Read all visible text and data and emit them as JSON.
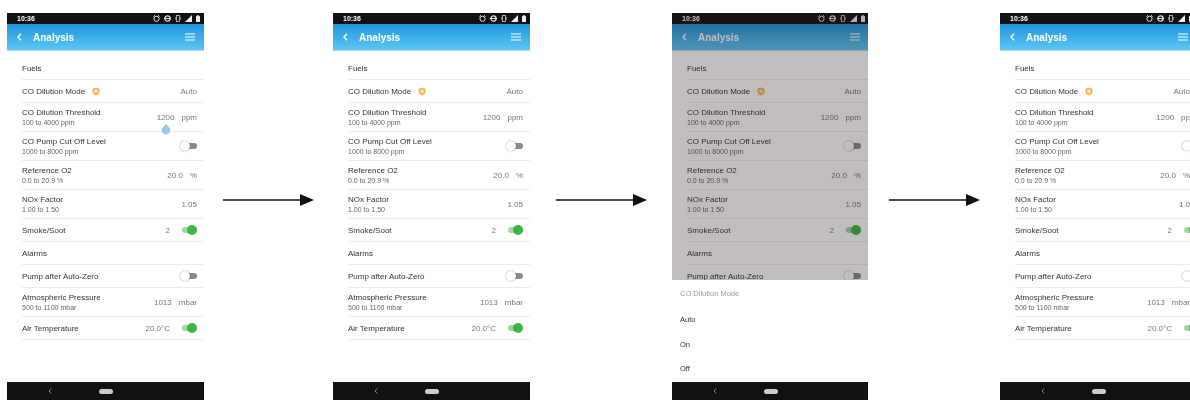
{
  "screens": [
    {
      "status_bar": {
        "time": "10:36"
      },
      "app_bar": {
        "title": "Analysis"
      },
      "dimmed": false,
      "rows": [
        {
          "kind": "section",
          "label": "Fuels"
        },
        {
          "kind": "setting",
          "label": "CO Dilution Mode",
          "badge": true,
          "value": "Auto"
        },
        {
          "kind": "setting",
          "label": "CO Dilution Threshold",
          "range": "100 to 4000 ppm",
          "value": "1200",
          "unit": "ppm",
          "handle": true
        },
        {
          "kind": "toggle",
          "label": "CO Pump Cut Off Level",
          "range": "1000 to 8000 ppm",
          "on": false
        },
        {
          "kind": "setting",
          "label": "Reference O2",
          "range": "0.0 to 20.9 %",
          "value": "20.0",
          "unit": "%"
        },
        {
          "kind": "setting",
          "label": "NOx Factor",
          "range": "1.00 to 1.50",
          "value": "1.05"
        },
        {
          "kind": "toggle",
          "label": "Smoke/Soot",
          "value": "2",
          "on": true
        },
        {
          "kind": "section",
          "label": "Alarms"
        },
        {
          "kind": "toggle",
          "label": "Pump after Auto-Zero",
          "on": false
        },
        {
          "kind": "setting",
          "label": "Atmospheric Pressure",
          "range": "500 to 1100 mbar",
          "value": "1013",
          "unit": "mbar"
        },
        {
          "kind": "toggle",
          "label": "Air Temperature",
          "value": "20.0°C",
          "on": true
        }
      ]
    },
    {
      "status_bar": {
        "time": "10:36"
      },
      "app_bar": {
        "title": "Analysis"
      },
      "dimmed": false,
      "rows": [
        {
          "kind": "section",
          "label": "Fuels"
        },
        {
          "kind": "setting",
          "label": "CO Dilution Mode",
          "badge": true,
          "value": "Auto"
        },
        {
          "kind": "setting",
          "label": "CO Dilution Threshold",
          "range": "100 to 4000 ppm",
          "value": "1200",
          "unit": "ppm"
        },
        {
          "kind": "toggle",
          "label": "CO Pump Cut Off Level",
          "range": "1000 to 8000 ppm",
          "on": false
        },
        {
          "kind": "setting",
          "label": "Reference O2",
          "range": "0.0 to 20.9 %",
          "value": "20.0",
          "unit": "%"
        },
        {
          "kind": "setting",
          "label": "NOx Factor",
          "range": "1.00 to 1.50",
          "value": "1.05"
        },
        {
          "kind": "toggle",
          "label": "Smoke/Soot",
          "value": "2",
          "on": true
        },
        {
          "kind": "section",
          "label": "Alarms"
        },
        {
          "kind": "toggle",
          "label": "Pump after Auto-Zero",
          "on": false
        },
        {
          "kind": "setting",
          "label": "Atmospheric Pressure",
          "range": "500 to 1100 mbar",
          "value": "1013",
          "unit": "mbar"
        },
        {
          "kind": "toggle",
          "label": "Air Temperature",
          "value": "20.0°C",
          "on": true
        }
      ]
    },
    {
      "status_bar": {
        "time": "10:36"
      },
      "app_bar": {
        "title": "Analysis"
      },
      "dimmed": true,
      "rows": [
        {
          "kind": "section",
          "label": "Fuels"
        },
        {
          "kind": "setting",
          "label": "CO Dilution Mode",
          "badge": true,
          "value": "Auto"
        },
        {
          "kind": "setting",
          "label": "CO Dilution Threshold",
          "range": "100 to 4000 ppm",
          "value": "1200",
          "unit": "ppm"
        },
        {
          "kind": "toggle",
          "label": "CO Pump Cut Off Level",
          "range": "1000 to 8000 ppm",
          "on": false
        },
        {
          "kind": "setting",
          "label": "Reference O2",
          "range": "0.0 to 20.9 %",
          "value": "20.0",
          "unit": "%"
        },
        {
          "kind": "setting",
          "label": "NOx Factor",
          "range": "1.00 to 1.50",
          "value": "1.05"
        },
        {
          "kind": "toggle",
          "label": "Smoke/Soot",
          "value": "2",
          "on": true
        },
        {
          "kind": "section",
          "label": "Alarms"
        },
        {
          "kind": "toggle",
          "label": "Pump after Auto-Zero",
          "on": false
        }
      ],
      "sheet": {
        "title": "CO Dilution Mode",
        "options": [
          "Auto",
          "On",
          "Off"
        ]
      }
    },
    {
      "status_bar": {
        "time": "10:36"
      },
      "app_bar": {
        "title": "Analysis"
      },
      "dimmed": false,
      "rows": [
        {
          "kind": "section",
          "label": "Fuels"
        },
        {
          "kind": "setting",
          "label": "CO Dilution Mode",
          "badge": true,
          "value": "Auto"
        },
        {
          "kind": "setting",
          "label": "CO Dilution Threshold",
          "range": "100 to 4000 ppm",
          "value": "1200",
          "unit": "pp"
        },
        {
          "kind": "toggle",
          "label": "CO Pump Cut Off Level",
          "range": "1000 to 8000 ppm",
          "on": false
        },
        {
          "kind": "setting",
          "label": "Reference O2",
          "range": "0.0 to 20.9 %",
          "value": "20.0",
          "unit": "%"
        },
        {
          "kind": "setting",
          "label": "NOx Factor",
          "range": "1.00 to 1.50",
          "value": "1.0"
        },
        {
          "kind": "toggle",
          "label": "Smoke/Soot",
          "value": "2",
          "on": true
        },
        {
          "kind": "section",
          "label": "Alarms"
        },
        {
          "kind": "toggle",
          "label": "Pump after Auto-Zero",
          "on": false
        },
        {
          "kind": "setting",
          "label": "Atmospheric Pressure",
          "range": "500 to 1100 mbar",
          "value": "1013",
          "unit": "mbar"
        },
        {
          "kind": "toggle",
          "label": "Air Temperature",
          "value": "20.0°C",
          "on": true
        }
      ]
    }
  ]
}
